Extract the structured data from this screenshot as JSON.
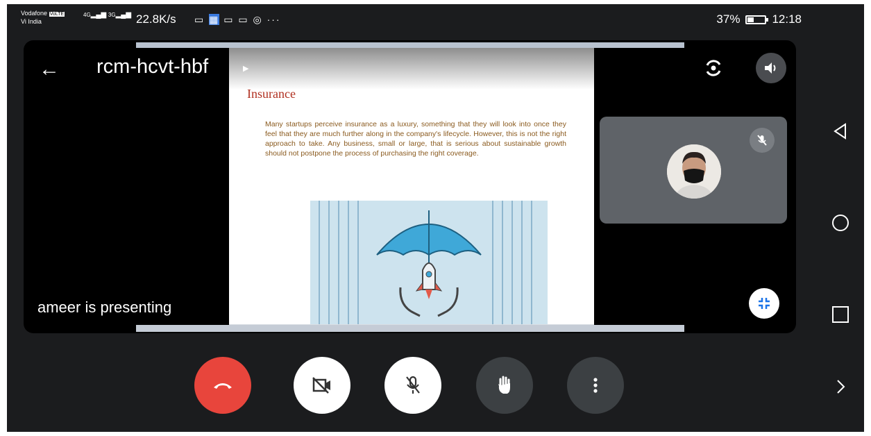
{
  "status_bar": {
    "carrier_name": "Vodafone",
    "carrier_badge": "VoLTE",
    "carrier_sub": "Vi India",
    "network": "4G",
    "network2": "3G",
    "speed": "22.8K/s",
    "battery": "37%",
    "time": "12:18"
  },
  "meeting": {
    "code": "rcm-hcvt-hbf",
    "presenting_text": "ameer is presenting"
  },
  "slide": {
    "title": "Insurance",
    "body": "Many startups perceive insurance as a luxury, something that they will look into once they feel that they are much further along in the company's lifecycle. However, this is not the right approach to take. Any business, small or large, that is serious about sustainable growth should not postpone the process of purchasing the right coverage."
  },
  "controls": [
    {
      "name": "end-call-button",
      "icon": "phone-hangup-icon",
      "color": "#e8453c"
    },
    {
      "name": "camera-toggle-button",
      "icon": "camera-off-icon",
      "color": "#ffffff"
    },
    {
      "name": "mic-toggle-button",
      "icon": "mic-off-icon",
      "color": "#ffffff"
    },
    {
      "name": "raise-hand-button",
      "icon": "hand-icon",
      "color": "#3c4043"
    },
    {
      "name": "more-options-button",
      "icon": "more-vert-icon",
      "color": "#3c4043"
    }
  ],
  "colors": {
    "end_call": "#e8453c",
    "tile_bg": "#5f6368",
    "dark_button": "#3c4043",
    "slide_title": "#b03020",
    "slide_text": "#8a5a1e"
  }
}
